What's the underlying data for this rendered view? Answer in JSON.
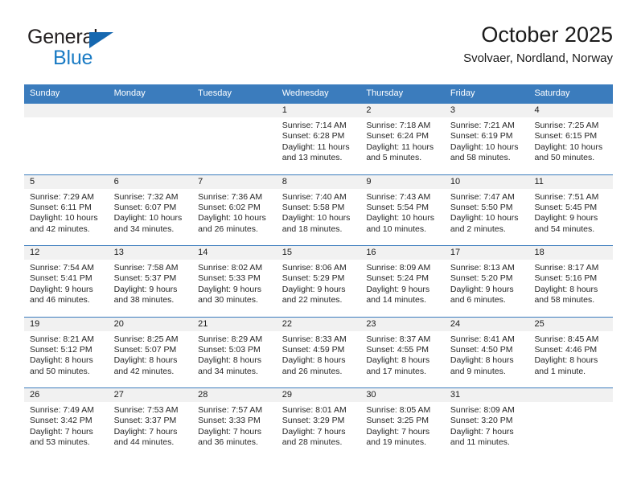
{
  "brand": {
    "name_part1": "General",
    "name_part2": "Blue",
    "logo_icon": "triangle-logo-icon"
  },
  "header": {
    "month_title": "October 2025",
    "location": "Svolvaer, Nordland, Norway"
  },
  "colors": {
    "header_blue": "#3b7cbd",
    "brand_blue": "#1a7bc4",
    "day_band_gray": "#f1f1f1",
    "text": "#1a1a1a"
  },
  "weekdays": [
    "Sunday",
    "Monday",
    "Tuesday",
    "Wednesday",
    "Thursday",
    "Friday",
    "Saturday"
  ],
  "weeks": [
    [
      {
        "day": "",
        "empty": true
      },
      {
        "day": "",
        "empty": true
      },
      {
        "day": "",
        "empty": true
      },
      {
        "day": "1",
        "sunrise": "Sunrise: 7:14 AM",
        "sunset": "Sunset: 6:28 PM",
        "daylight1": "Daylight: 11 hours",
        "daylight2": "and 13 minutes."
      },
      {
        "day": "2",
        "sunrise": "Sunrise: 7:18 AM",
        "sunset": "Sunset: 6:24 PM",
        "daylight1": "Daylight: 11 hours",
        "daylight2": "and 5 minutes."
      },
      {
        "day": "3",
        "sunrise": "Sunrise: 7:21 AM",
        "sunset": "Sunset: 6:19 PM",
        "daylight1": "Daylight: 10 hours",
        "daylight2": "and 58 minutes."
      },
      {
        "day": "4",
        "sunrise": "Sunrise: 7:25 AM",
        "sunset": "Sunset: 6:15 PM",
        "daylight1": "Daylight: 10 hours",
        "daylight2": "and 50 minutes."
      }
    ],
    [
      {
        "day": "5",
        "sunrise": "Sunrise: 7:29 AM",
        "sunset": "Sunset: 6:11 PM",
        "daylight1": "Daylight: 10 hours",
        "daylight2": "and 42 minutes."
      },
      {
        "day": "6",
        "sunrise": "Sunrise: 7:32 AM",
        "sunset": "Sunset: 6:07 PM",
        "daylight1": "Daylight: 10 hours",
        "daylight2": "and 34 minutes."
      },
      {
        "day": "7",
        "sunrise": "Sunrise: 7:36 AM",
        "sunset": "Sunset: 6:02 PM",
        "daylight1": "Daylight: 10 hours",
        "daylight2": "and 26 minutes."
      },
      {
        "day": "8",
        "sunrise": "Sunrise: 7:40 AM",
        "sunset": "Sunset: 5:58 PM",
        "daylight1": "Daylight: 10 hours",
        "daylight2": "and 18 minutes."
      },
      {
        "day": "9",
        "sunrise": "Sunrise: 7:43 AM",
        "sunset": "Sunset: 5:54 PM",
        "daylight1": "Daylight: 10 hours",
        "daylight2": "and 10 minutes."
      },
      {
        "day": "10",
        "sunrise": "Sunrise: 7:47 AM",
        "sunset": "Sunset: 5:50 PM",
        "daylight1": "Daylight: 10 hours",
        "daylight2": "and 2 minutes."
      },
      {
        "day": "11",
        "sunrise": "Sunrise: 7:51 AM",
        "sunset": "Sunset: 5:45 PM",
        "daylight1": "Daylight: 9 hours",
        "daylight2": "and 54 minutes."
      }
    ],
    [
      {
        "day": "12",
        "sunrise": "Sunrise: 7:54 AM",
        "sunset": "Sunset: 5:41 PM",
        "daylight1": "Daylight: 9 hours",
        "daylight2": "and 46 minutes."
      },
      {
        "day": "13",
        "sunrise": "Sunrise: 7:58 AM",
        "sunset": "Sunset: 5:37 PM",
        "daylight1": "Daylight: 9 hours",
        "daylight2": "and 38 minutes."
      },
      {
        "day": "14",
        "sunrise": "Sunrise: 8:02 AM",
        "sunset": "Sunset: 5:33 PM",
        "daylight1": "Daylight: 9 hours",
        "daylight2": "and 30 minutes."
      },
      {
        "day": "15",
        "sunrise": "Sunrise: 8:06 AM",
        "sunset": "Sunset: 5:29 PM",
        "daylight1": "Daylight: 9 hours",
        "daylight2": "and 22 minutes."
      },
      {
        "day": "16",
        "sunrise": "Sunrise: 8:09 AM",
        "sunset": "Sunset: 5:24 PM",
        "daylight1": "Daylight: 9 hours",
        "daylight2": "and 14 minutes."
      },
      {
        "day": "17",
        "sunrise": "Sunrise: 8:13 AM",
        "sunset": "Sunset: 5:20 PM",
        "daylight1": "Daylight: 9 hours",
        "daylight2": "and 6 minutes."
      },
      {
        "day": "18",
        "sunrise": "Sunrise: 8:17 AM",
        "sunset": "Sunset: 5:16 PM",
        "daylight1": "Daylight: 8 hours",
        "daylight2": "and 58 minutes."
      }
    ],
    [
      {
        "day": "19",
        "sunrise": "Sunrise: 8:21 AM",
        "sunset": "Sunset: 5:12 PM",
        "daylight1": "Daylight: 8 hours",
        "daylight2": "and 50 minutes."
      },
      {
        "day": "20",
        "sunrise": "Sunrise: 8:25 AM",
        "sunset": "Sunset: 5:07 PM",
        "daylight1": "Daylight: 8 hours",
        "daylight2": "and 42 minutes."
      },
      {
        "day": "21",
        "sunrise": "Sunrise: 8:29 AM",
        "sunset": "Sunset: 5:03 PM",
        "daylight1": "Daylight: 8 hours",
        "daylight2": "and 34 minutes."
      },
      {
        "day": "22",
        "sunrise": "Sunrise: 8:33 AM",
        "sunset": "Sunset: 4:59 PM",
        "daylight1": "Daylight: 8 hours",
        "daylight2": "and 26 minutes."
      },
      {
        "day": "23",
        "sunrise": "Sunrise: 8:37 AM",
        "sunset": "Sunset: 4:55 PM",
        "daylight1": "Daylight: 8 hours",
        "daylight2": "and 17 minutes."
      },
      {
        "day": "24",
        "sunrise": "Sunrise: 8:41 AM",
        "sunset": "Sunset: 4:50 PM",
        "daylight1": "Daylight: 8 hours",
        "daylight2": "and 9 minutes."
      },
      {
        "day": "25",
        "sunrise": "Sunrise: 8:45 AM",
        "sunset": "Sunset: 4:46 PM",
        "daylight1": "Daylight: 8 hours",
        "daylight2": "and 1 minute."
      }
    ],
    [
      {
        "day": "26",
        "sunrise": "Sunrise: 7:49 AM",
        "sunset": "Sunset: 3:42 PM",
        "daylight1": "Daylight: 7 hours",
        "daylight2": "and 53 minutes."
      },
      {
        "day": "27",
        "sunrise": "Sunrise: 7:53 AM",
        "sunset": "Sunset: 3:37 PM",
        "daylight1": "Daylight: 7 hours",
        "daylight2": "and 44 minutes."
      },
      {
        "day": "28",
        "sunrise": "Sunrise: 7:57 AM",
        "sunset": "Sunset: 3:33 PM",
        "daylight1": "Daylight: 7 hours",
        "daylight2": "and 36 minutes."
      },
      {
        "day": "29",
        "sunrise": "Sunrise: 8:01 AM",
        "sunset": "Sunset: 3:29 PM",
        "daylight1": "Daylight: 7 hours",
        "daylight2": "and 28 minutes."
      },
      {
        "day": "30",
        "sunrise": "Sunrise: 8:05 AM",
        "sunset": "Sunset: 3:25 PM",
        "daylight1": "Daylight: 7 hours",
        "daylight2": "and 19 minutes."
      },
      {
        "day": "31",
        "sunrise": "Sunrise: 8:09 AM",
        "sunset": "Sunset: 3:20 PM",
        "daylight1": "Daylight: 7 hours",
        "daylight2": "and 11 minutes."
      },
      {
        "day": "",
        "empty": true
      }
    ]
  ]
}
